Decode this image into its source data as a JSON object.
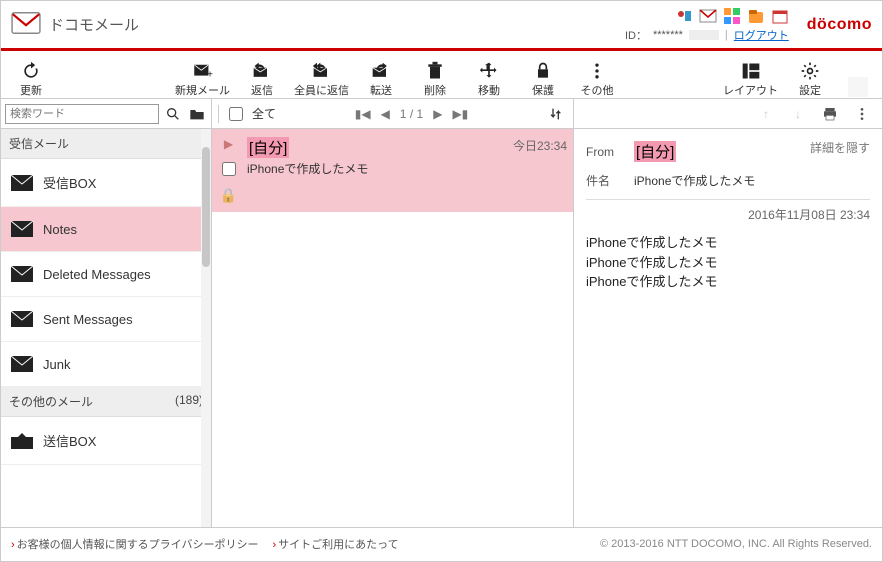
{
  "header": {
    "app_title": "ドコモメール",
    "id_label": "ID：",
    "id_value": "*******",
    "logout": "ログアウト",
    "brand": "döcomo"
  },
  "toolbar": {
    "refresh": "更新",
    "compose": "新規メール",
    "reply": "返信",
    "reply_all": "全員に返信",
    "forward": "転送",
    "delete": "削除",
    "move": "移動",
    "protect": "保護",
    "other": "その他",
    "layout": "レイアウト",
    "settings": "設定"
  },
  "subbar": {
    "search_placeholder": "検索ワード",
    "all_label": "全て",
    "pager_current": "1",
    "pager_sep": "/",
    "pager_total": "1"
  },
  "sidebar": {
    "group1_title": "受信メール",
    "group2_title": "その他のメール",
    "group2_count": "(189)",
    "items": [
      {
        "label": "受信BOX"
      },
      {
        "label": "Notes"
      },
      {
        "label": "Deleted Messages"
      },
      {
        "label": "Sent Messages"
      },
      {
        "label": "Junk"
      }
    ],
    "outbox": "送信BOX"
  },
  "list": {
    "msg": {
      "sender": "[自分]",
      "subject": "iPhoneで作成したメモ",
      "date": "今日23:34"
    }
  },
  "preview": {
    "from_label": "From",
    "from_value": "[自分]",
    "subject_label": "件名",
    "subject_value": "iPhoneで作成したメモ",
    "detail_toggle": "詳細を隠す",
    "timestamp": "2016年11月08日 23:34",
    "body_lines": [
      "iPhoneで作成したメモ",
      "iPhoneで作成したメモ",
      "iPhoneで作成したメモ"
    ]
  },
  "footer": {
    "link1": "お客様の個人情報に関するプライバシーポリシー",
    "link2": "サイトご利用にあたって",
    "copyright": "© 2013-2016 NTT DOCOMO, INC. All Rights Reserved."
  }
}
